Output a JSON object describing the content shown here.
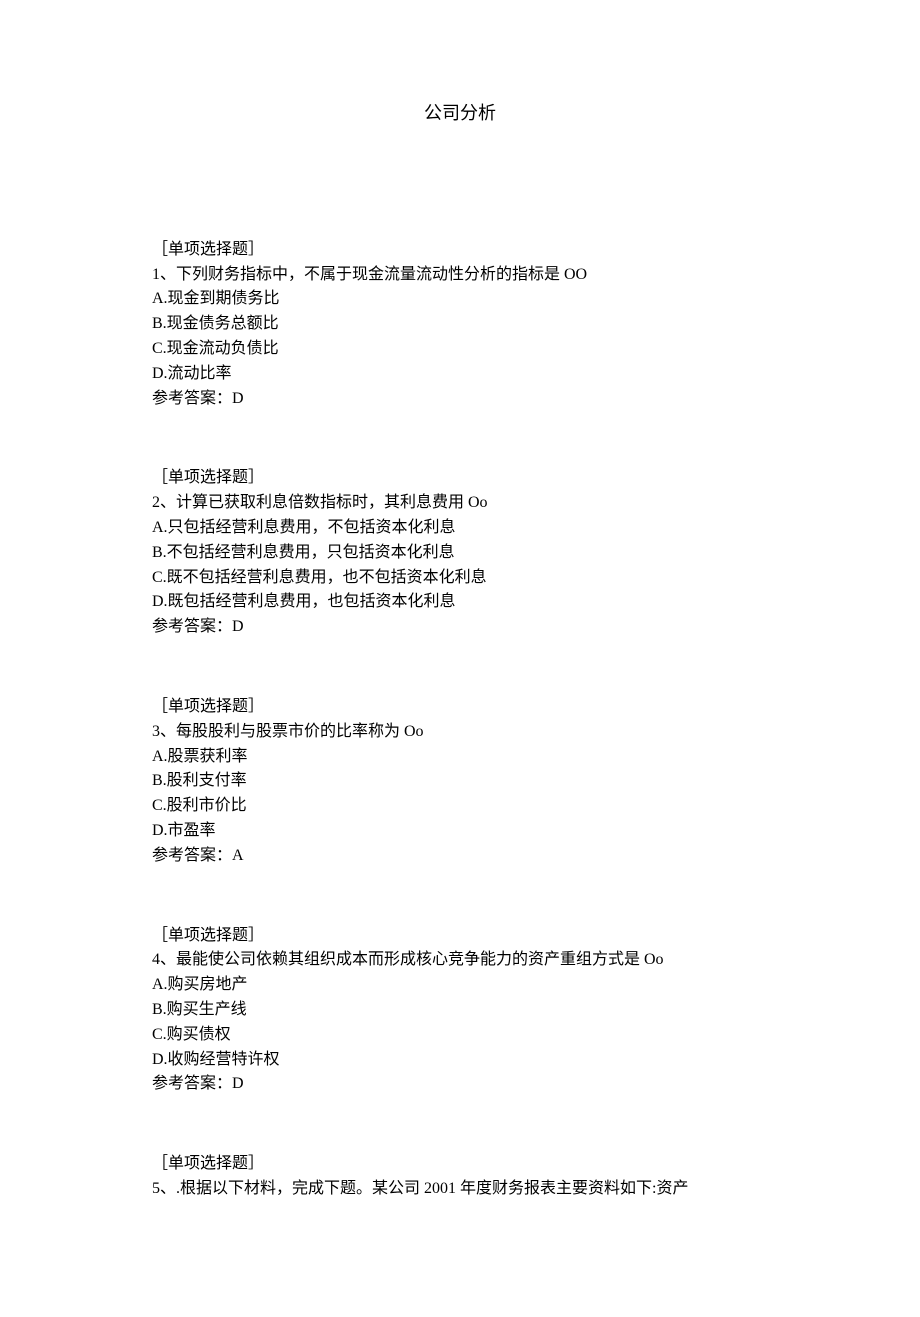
{
  "title": "公司分析",
  "questions": [
    {
      "type_label": "［单项选择题］",
      "stem": "1、下列财务指标中，不属于现金流量流动性分析的指标是 OO",
      "options": [
        "A.现金到期债务比",
        "B.现金债务总额比",
        "C.现金流动负债比",
        "D.流动比率"
      ],
      "answer_label": "参考答案：D"
    },
    {
      "type_label": "［单项选择题］",
      "stem": "2、计算已获取利息倍数指标时，其利息费用 Oo",
      "options": [
        "A.只包括经营利息费用，不包括资本化利息",
        "B.不包括经营利息费用，只包括资本化利息",
        "C.既不包括经营利息费用，也不包括资本化利息",
        "D.既包括经营利息费用，也包括资本化利息"
      ],
      "answer_label": "参考答案：D"
    },
    {
      "type_label": "［单项选择题］",
      "stem": "3、每股股利与股票市价的比率称为 Oo",
      "options": [
        "A.股票获利率",
        "B.股利支付率",
        "C.股利市价比",
        "D.市盈率"
      ],
      "answer_label": "参考答案：A"
    },
    {
      "type_label": "［单项选择题］",
      "stem": "4、最能使公司依赖其组织成本而形成核心竞争能力的资产重组方式是 Oo",
      "options": [
        "A.购买房地产",
        "B.购买生产线",
        "C.购买债权",
        "D.收购经营特许权"
      ],
      "answer_label": "参考答案：D"
    },
    {
      "type_label": "［单项选择题］",
      "stem": "5、.根据以下材料，完成下题。某公司 2001 年度财务报表主要资料如下:资产",
      "options": [],
      "answer_label": ""
    }
  ]
}
